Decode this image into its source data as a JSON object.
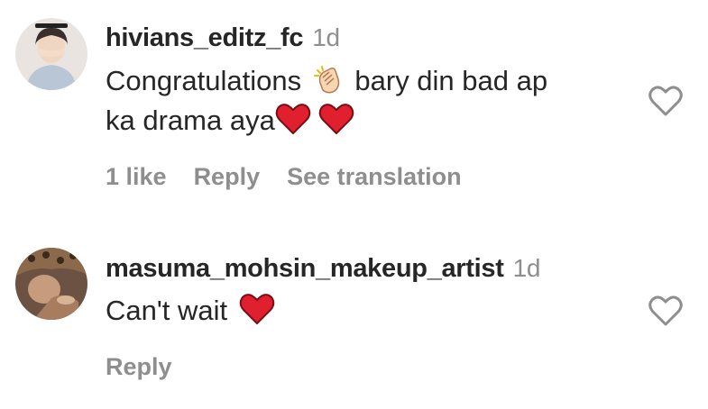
{
  "comments": [
    {
      "username": "hivians_editz_fc",
      "time": "1d",
      "text_part1": "Congratulations",
      "text_part2": "bary din bad ap",
      "text_line2": "ka drama aya",
      "likes": "1 like",
      "reply": "Reply",
      "translate": "See translation"
    },
    {
      "username": "masuma_mohsin_makeup_artist",
      "time": "1d",
      "text": "Can't wait",
      "reply": "Reply"
    }
  ],
  "icons": {
    "like": "heart-outline-icon",
    "clap": "clapping-hands-emoji",
    "heart": "red-heart-emoji"
  },
  "colors": {
    "text": "#262626",
    "secondary": "#8e8e8e",
    "heart_red": "#e0202f"
  }
}
